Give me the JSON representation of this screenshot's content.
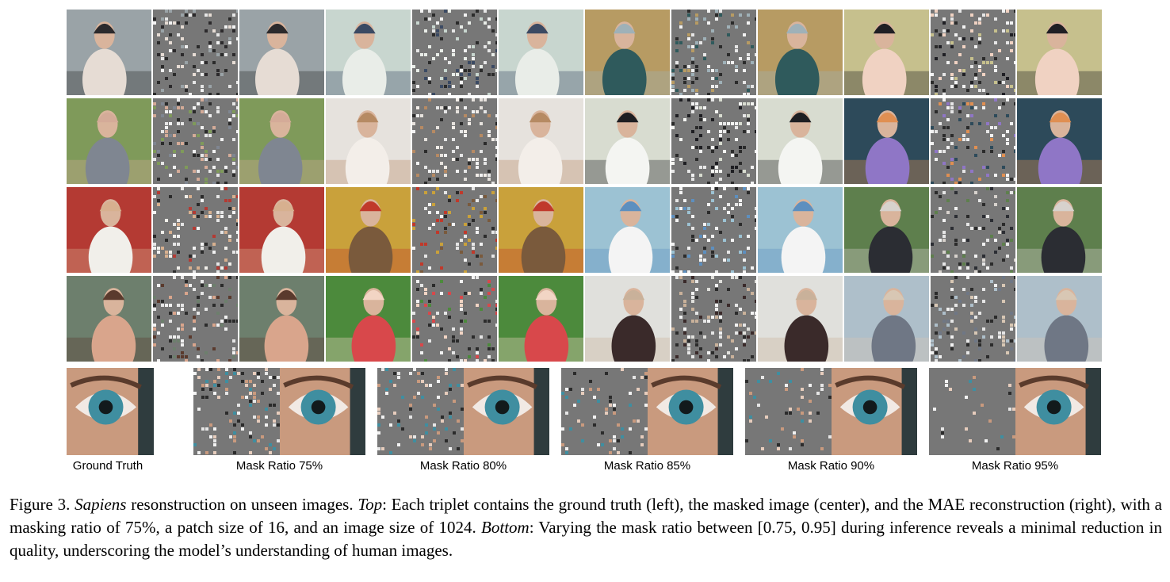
{
  "figure": {
    "grid_rows": 4,
    "grid_cols": 4,
    "triplet_parts": [
      "ground truth",
      "masked image",
      "MAE reconstruction"
    ],
    "scenes": [
      {
        "bg": "#9aa3a7",
        "subject": "#e6dcd4",
        "accent": "#2c2a2c"
      },
      {
        "bg": "#c8d6cf",
        "subject": "#e9ede8",
        "accent": "#3b4a63"
      },
      {
        "bg": "#b79b63",
        "subject": "#2f5a5c",
        "accent": "#9fb1b8"
      },
      {
        "bg": "#c6c08d",
        "subject": "#f0d2c2",
        "accent": "#1f1f24"
      },
      {
        "bg": "#7f9a5a",
        "subject": "#7f8691",
        "accent": "#d4ab98"
      },
      {
        "bg": "#e6e2dd",
        "subject": "#f3eee9",
        "accent": "#b68a63"
      },
      {
        "bg": "#d8dcd0",
        "subject": "#f4f5f2",
        "accent": "#1e1e22"
      },
      {
        "bg": "#2d4a5a",
        "subject": "#8f76c6",
        "accent": "#e08f52"
      },
      {
        "bg": "#b43a33",
        "subject": "#f1efea",
        "accent": "#d7b08f"
      },
      {
        "bg": "#c9a13b",
        "subject": "#7a5a3c",
        "accent": "#c0392b"
      },
      {
        "bg": "#9cc2d3",
        "subject": "#f4f4f4",
        "accent": "#5d8fbf"
      },
      {
        "bg": "#5e7f4d",
        "subject": "#2b2d33",
        "accent": "#d7d2cd"
      },
      {
        "bg": "#6d7f6d",
        "subject": "#d9a58c",
        "accent": "#5a3a2d"
      },
      {
        "bg": "#4c8a3c",
        "subject": "#d8484b",
        "accent": "#f2d5c4"
      },
      {
        "bg": "#e0e0dc",
        "subject": "#3a2a2a",
        "accent": "#c9b19a"
      },
      {
        "bg": "#aebfca",
        "subject": "#6f7785",
        "accent": "#d8c7b4"
      }
    ],
    "mask_gray": "#777777",
    "bottom": {
      "labels": [
        "Ground Truth",
        "Mask Ratio 75%",
        "Mask Ratio 80%",
        "Mask Ratio 85%",
        "Mask Ratio 90%",
        "Mask Ratio 95%"
      ],
      "ratios": [
        0,
        0.75,
        0.8,
        0.85,
        0.9,
        0.95
      ]
    },
    "caption": {
      "label": "Figure 3.",
      "model": "Sapiens",
      "part1": " resonstruction on unseen images. ",
      "top_label": "Top",
      "part2": ": Each triplet contains the ground truth (left), the masked image (center), and the MAE reconstruction (right), with a masking ratio of 75%, a patch size of 16, and an image size of 1024. ",
      "bottom_label": "Bottom",
      "part3": ": Varying the mask ratio between [0.75, 0.95] during inference reveals a minimal reduction in quality, underscoring the model’s understanding of human images."
    }
  }
}
